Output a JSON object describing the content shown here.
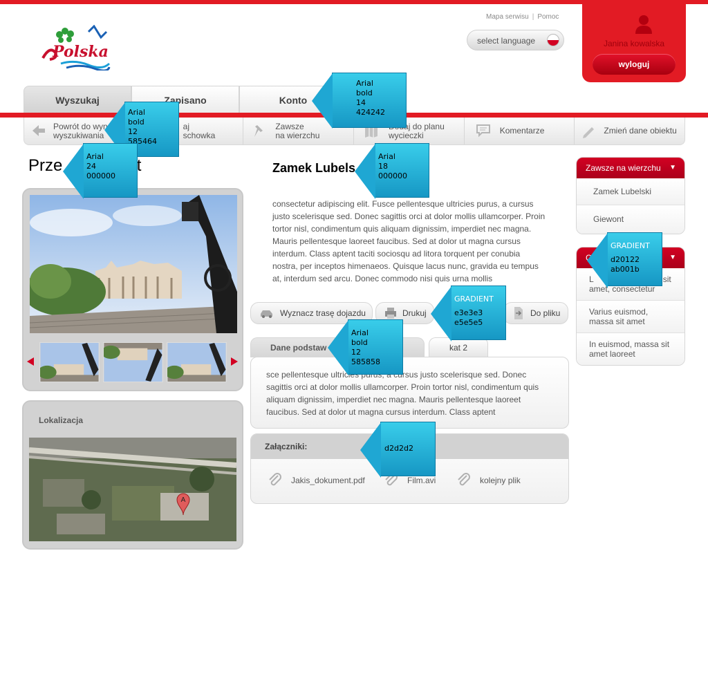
{
  "header": {
    "logo_text": "Polska",
    "links": [
      "Mapa serwisu",
      "Pomoc"
    ],
    "language_placeholder": "select language",
    "user_name": "Janina kowalska",
    "logout_label": "wyloguj"
  },
  "nav": {
    "tabs": [
      "Wyszukaj",
      "Zapisano",
      "Konto"
    ]
  },
  "toolbar": {
    "items": [
      {
        "line1": "Powrót do wyn",
        "line2": "wyszukiwania",
        "icon": "arrow-left-icon"
      },
      {
        "line1": "aj",
        "line2": "schowka",
        "icon": "clipboard-icon"
      },
      {
        "line1": "Zawsze",
        "line2": "na wierzchu",
        "icon": "pin-icon"
      },
      {
        "line1": "Dodaj do planu",
        "line2": "wycieczki",
        "icon": "map-icon"
      },
      {
        "line1": "Komentarze",
        "line2": "",
        "icon": "comment-icon"
      },
      {
        "line1": "Zmień dane obiektu",
        "line2": "",
        "icon": "pencil-icon"
      }
    ]
  },
  "page": {
    "title": "Prze",
    "title_tail": "ekt",
    "location_title": "Lokalizacja"
  },
  "object": {
    "name": "Zamek Lubels",
    "description": "consectetur adipiscing elit. Fusce pellentesque ultricies purus, a cursus justo scelerisque sed. Donec sagittis orci at dolor mollis ullamcorper. Proin tortor nisl, condimentum quis aliquam dignissim, imperdiet nec magna. Mauris pellentesque laoreet faucibus. Sed at dolor ut magna cursus interdum. Class aptent taciti sociosqu ad litora torquent per conubia nostra, per inceptos himenaeos. Quisque lacus nunc, gravida eu tempus at, interdum sed arcu. Donec commodo nisi quis urna mollis"
  },
  "actions": [
    "Wyznacz trasę dojazdu",
    "Drukuj",
    "Do pliku"
  ],
  "details": {
    "tabs": [
      "Dane podstaw",
      "kat 2"
    ],
    "text": "sce pellentesque ultricies purus, a cursus justo scelerisque sed. Donec sagittis orci at dolor mollis ullamcorper. Proin tortor nisl, condimentum quis aliquam dignissim, imperdiet nec magna. Mauris pellentesque laoreet faucibus. Sed at dolor ut magna cursus interdum. Class aptent"
  },
  "attachments": {
    "title": "Załączniki:",
    "files": [
      "Jakis_dokument.pdf",
      "Film.avi",
      "kolejny plik"
    ]
  },
  "sidebar": {
    "pinned_title": "Zawsze na wierzchu",
    "pinned_items": [
      "Zamek Lubelski",
      "Giewont"
    ],
    "second_title": "C",
    "second_items": [
      {
        "line1": "L",
        "line1_tail": "sit",
        "line2": "amet, consectetur"
      },
      {
        "line1": "Varius euismod,",
        "line2": "massa sit amet"
      },
      {
        "line1": "In euismod, massa sit",
        "line2": "amet laoreet"
      }
    ]
  },
  "annotations": [
    {
      "lines": [
        "Arial",
        "bold",
        "14",
        "424242"
      ]
    },
    {
      "lines": [
        "Arial",
        "bold",
        "12",
        "585464"
      ]
    },
    {
      "lines": [
        "Arial",
        "24",
        "000000"
      ]
    },
    {
      "lines": [
        "Arial",
        "18",
        "000000"
      ]
    },
    {
      "lines": [
        "GRADIENT",
        "d20122",
        "ab001b"
      ]
    },
    {
      "lines": [
        "GRADIENT",
        "e3e3e3",
        "e5e5e5"
      ]
    },
    {
      "lines": [
        "Arial",
        "bold",
        "12",
        "585858"
      ]
    },
    {
      "lines": [
        "d2d2d2"
      ]
    }
  ],
  "colors": {
    "brand_red": "#e21b24",
    "sidebar_gradient_top": "#d20122",
    "sidebar_gradient_bottom": "#ab001b",
    "panel_gray": "#d2d2d2",
    "callout_blue": "#2bb6dd"
  }
}
